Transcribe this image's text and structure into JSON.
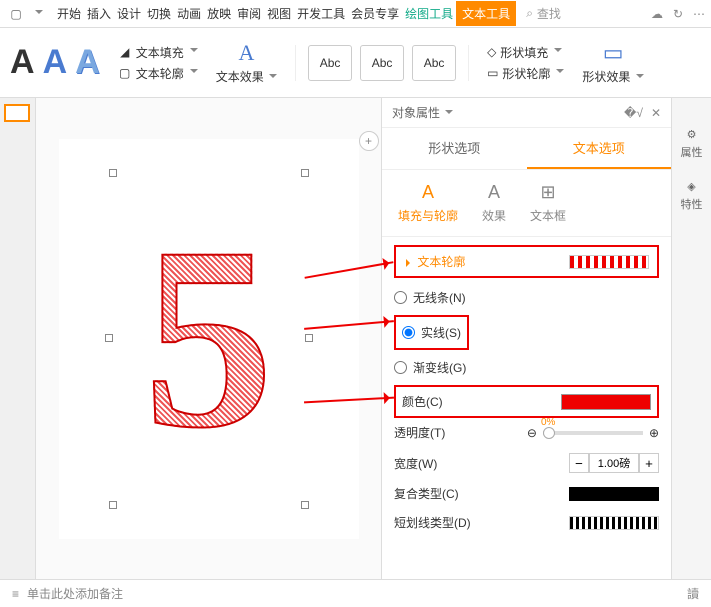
{
  "menubar": {
    "tabs": [
      "开始",
      "插入",
      "设计",
      "切换",
      "动画",
      "放映",
      "审阅",
      "视图",
      "开发工具",
      "会员专享"
    ],
    "tab_green": "绘图工具",
    "tab_orange": "文本工具",
    "search_placeholder": "查找"
  },
  "ribbon": {
    "text_fill": "文本填充",
    "text_outline": "文本轮廓",
    "text_effect": "文本效果",
    "abc": "Abc",
    "shape_fill": "形状填充",
    "shape_outline": "形状轮廓",
    "shape_effect": "形状效果"
  },
  "panel": {
    "title": "对象属性",
    "tab_shape": "形状选项",
    "tab_text": "文本选项",
    "sub_fill": "填充与轮廓",
    "sub_effect": "效果",
    "sub_textbox": "文本框",
    "section_title": "文本轮廓",
    "radio_none": "无线条(N)",
    "radio_solid": "实线(S)",
    "radio_gradient": "渐变线(G)",
    "prop_color": "颜色(C)",
    "prop_opacity": "透明度(T)",
    "opacity_value": "0%",
    "prop_width": "宽度(W)",
    "width_value": "1.00磅",
    "prop_compound": "复合类型(C)",
    "prop_dash": "短划线类型(D)"
  },
  "rail": {
    "attr": "属性",
    "spec": "特性"
  },
  "notes": {
    "placeholder": "单击此处添加备注",
    "right": "讀"
  }
}
